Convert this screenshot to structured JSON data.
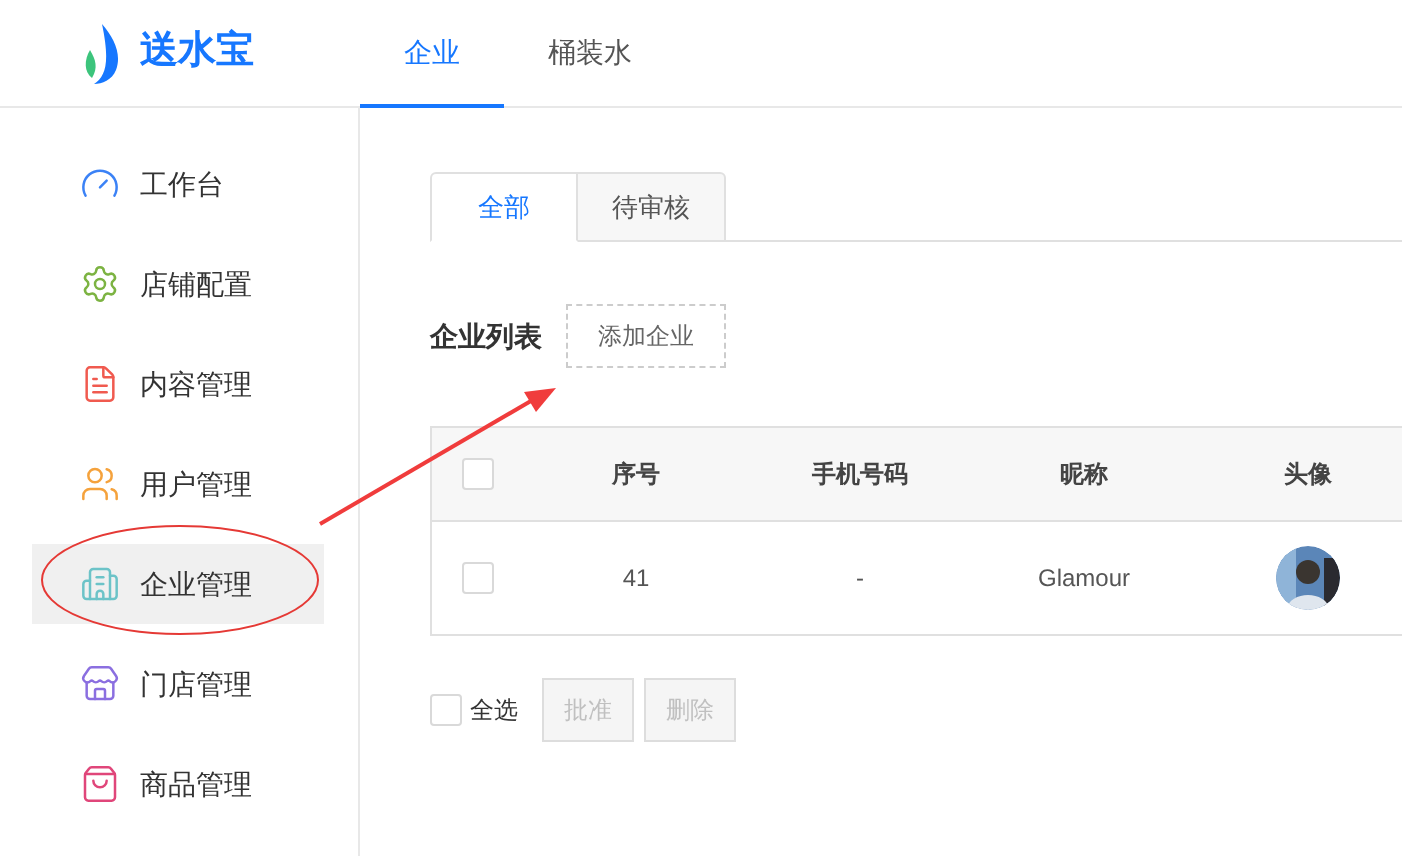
{
  "logo": {
    "text": "送水宝"
  },
  "nav_tabs": [
    {
      "label": "企业",
      "selected": true
    },
    {
      "label": "桶装水",
      "selected": false
    }
  ],
  "sidebar": {
    "items": [
      {
        "label": "工作台",
        "selected": false
      },
      {
        "label": "店铺配置",
        "selected": false
      },
      {
        "label": "内容管理",
        "selected": false
      },
      {
        "label": "用户管理",
        "selected": false
      },
      {
        "label": "企业管理",
        "selected": true
      },
      {
        "label": "门店管理",
        "selected": false
      },
      {
        "label": "商品管理",
        "selected": false
      }
    ]
  },
  "content_tabs": [
    {
      "label": "全部",
      "selected": true
    },
    {
      "label": "待审核",
      "selected": false
    }
  ],
  "section_title": "企业列表",
  "add_button": "添加企业",
  "table": {
    "header_checked": false,
    "columns": [
      "序号",
      "手机号码",
      "昵称",
      "头像"
    ],
    "rows": [
      {
        "checked": false,
        "cells": [
          "41",
          "-",
          "Glamour"
        ],
        "avatar": {
          "kind": "picture"
        }
      }
    ]
  },
  "footer": {
    "select_all": {
      "label": "全选",
      "checked": false
    },
    "buttons": [
      {
        "label": "批准",
        "disabled": true
      },
      {
        "label": "删除",
        "disabled": true
      }
    ]
  }
}
